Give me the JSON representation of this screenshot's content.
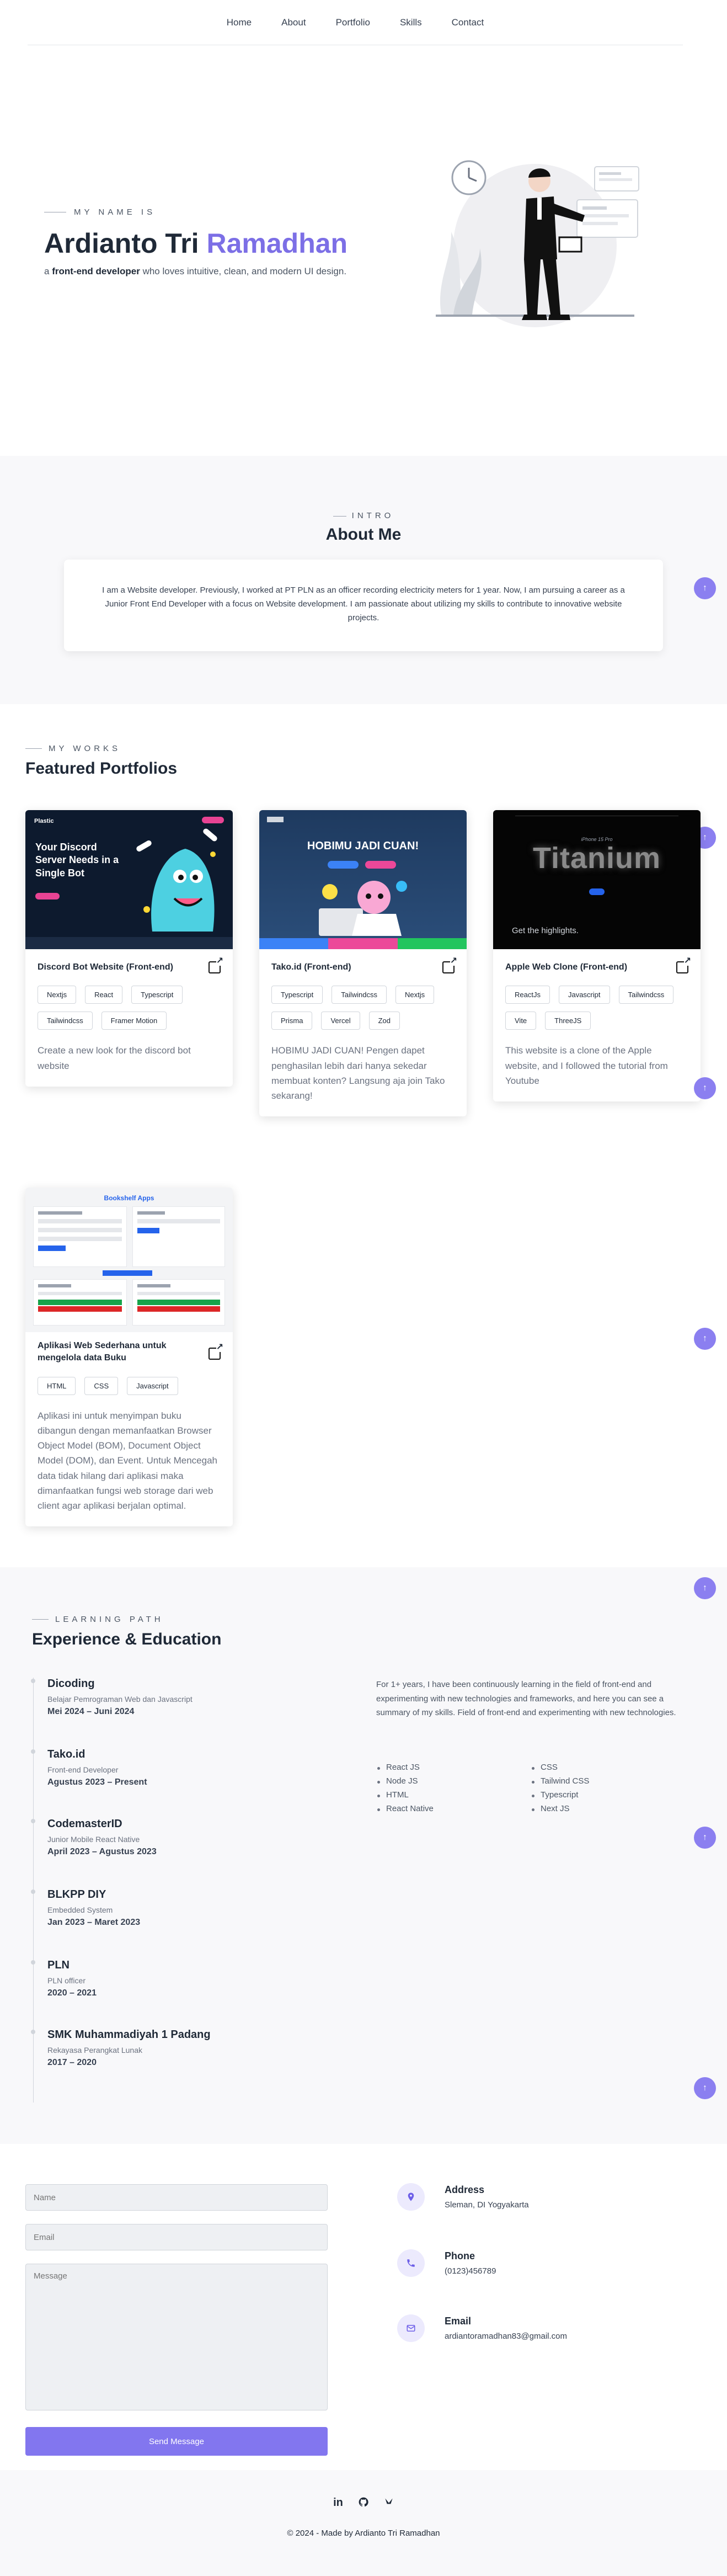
{
  "nav": {
    "items": [
      "Home",
      "About",
      "Portfolio",
      "Skills",
      "Contact"
    ]
  },
  "hero": {
    "eyebrow": "MY NAME IS",
    "name_first": "Ardianto Tri",
    "name_accent": "Ramadhan",
    "sub_prefix": "a",
    "sub_bold": "front-end developer",
    "sub_rest": "who loves intuitive, clean, and modern UI design."
  },
  "about": {
    "eyebrow": "INTRO",
    "title": "About Me",
    "text": "I am a Website developer. Previously, I worked at PT PLN as an officer recording electricity meters for 1 year. Now, I am pursuing a career as a Junior Front End Developer with a focus on Website development. I am passionate about utilizing my skills to contribute to innovative website projects."
  },
  "portfolio": {
    "eyebrow": "MY WORKS",
    "title": "Featured Portfolios",
    "cards": [
      {
        "title": "Discord Bot Website (Front-end)",
        "tags": [
          "Nextjs",
          "React",
          "Typescript",
          "Tailwindcss",
          "Framer Motion"
        ],
        "desc": "Create a new look for the discord bot website",
        "thumb_heading": "Your Discord Server Needs in a Single Bot",
        "thumb_brand": "Plastic"
      },
      {
        "title": "Tako.id (Front-end)",
        "tags": [
          "Typescript",
          "Tailwindcss",
          "Nextjs",
          "Prisma",
          "Vercel",
          "Zod"
        ],
        "desc": "HOBIMU JADI CUAN! Pengen dapet penghasilan lebih dari hanya sekedar membuat konten? Langsung aja join Tako sekarang!",
        "thumb_heading": "HOBIMU JADI CUAN!"
      },
      {
        "title": "Apple Web Clone (Front-end)",
        "tags": [
          "ReactJs",
          "Javascript",
          "Tailwindcss",
          "Vite",
          "ThreeJS"
        ],
        "desc": "This website is a clone of the Apple website, and I followed the tutorial from Youtube",
        "thumb_heading": "Titanium",
        "thumb_caption": "Get the highlights."
      },
      {
        "title": "Aplikasi Web Sederhana untuk mengelola data Buku",
        "tags": [
          "HTML",
          "CSS",
          "Javascript"
        ],
        "desc": "Aplikasi ini untuk menyimpan buku dibangun dengan memanfaatkan Browser Object Model (BOM), Document Object Model (DOM), dan Event. Untuk Mencegah data tidak hilang dari aplikasi maka dimanfaatkan fungsi web storage dari web client agar aplikasi berjalan optimal.",
        "thumb_heading": "Bookshelf Apps"
      }
    ]
  },
  "experience": {
    "eyebrow": "LEARNING PATH",
    "title": "Experience & Education",
    "items": [
      {
        "title": "Dicoding",
        "role": "Belajar Pemrograman Web dan Javascript",
        "date": "Mei 2024 – Juni 2024"
      },
      {
        "title": "Tako.id",
        "role": "Front-end Developer",
        "date": "Agustus 2023 – Present"
      },
      {
        "title": "CodemasterID",
        "role": "Junior Mobile React Native",
        "date": "April 2023 – Agustus 2023"
      },
      {
        "title": "BLKPP DIY",
        "role": "Embedded System",
        "date": "Jan 2023 – Maret 2023"
      },
      {
        "title": "PLN",
        "role": "PLN officer",
        "date": "2020 – 2021"
      },
      {
        "title": "SMK Muhammadiyah 1 Padang",
        "role": "Rekayasa Perangkat Lunak",
        "date": "2017 – 2020"
      }
    ],
    "summary": "For 1+ years, I have been continuously learning in the field of front-end and experimenting with new technologies and frameworks, and here you can see a summary of my skills. Field of front-end and experimenting with new technologies.",
    "skills": [
      "React JS",
      "CSS",
      "Node JS",
      "Tailwind CSS",
      "HTML",
      "Typescript",
      "React Native",
      "Next JS"
    ]
  },
  "contact": {
    "name_placeholder": "Name",
    "email_placeholder": "Email",
    "message_placeholder": "Message",
    "send_label": "Send Message",
    "address_label": "Address",
    "address_value": "Sleman, DI Yogyakarta",
    "phone_label": "Phone",
    "phone_value": "(0123)456789",
    "email_label": "Email",
    "email_value": "ardiantoramadhan83@gmail.com"
  },
  "float_button": {
    "icon": "↑"
  },
  "footer": {
    "socials": [
      "linkedin-icon",
      "github-icon",
      "codepen-icon"
    ],
    "copyright": "© 2024 - Made by Ardianto Tri Ramadhan"
  },
  "colors": {
    "accent": "#7c6fe6",
    "button": "#8276ef",
    "section_bg": "#f8f8fa"
  }
}
